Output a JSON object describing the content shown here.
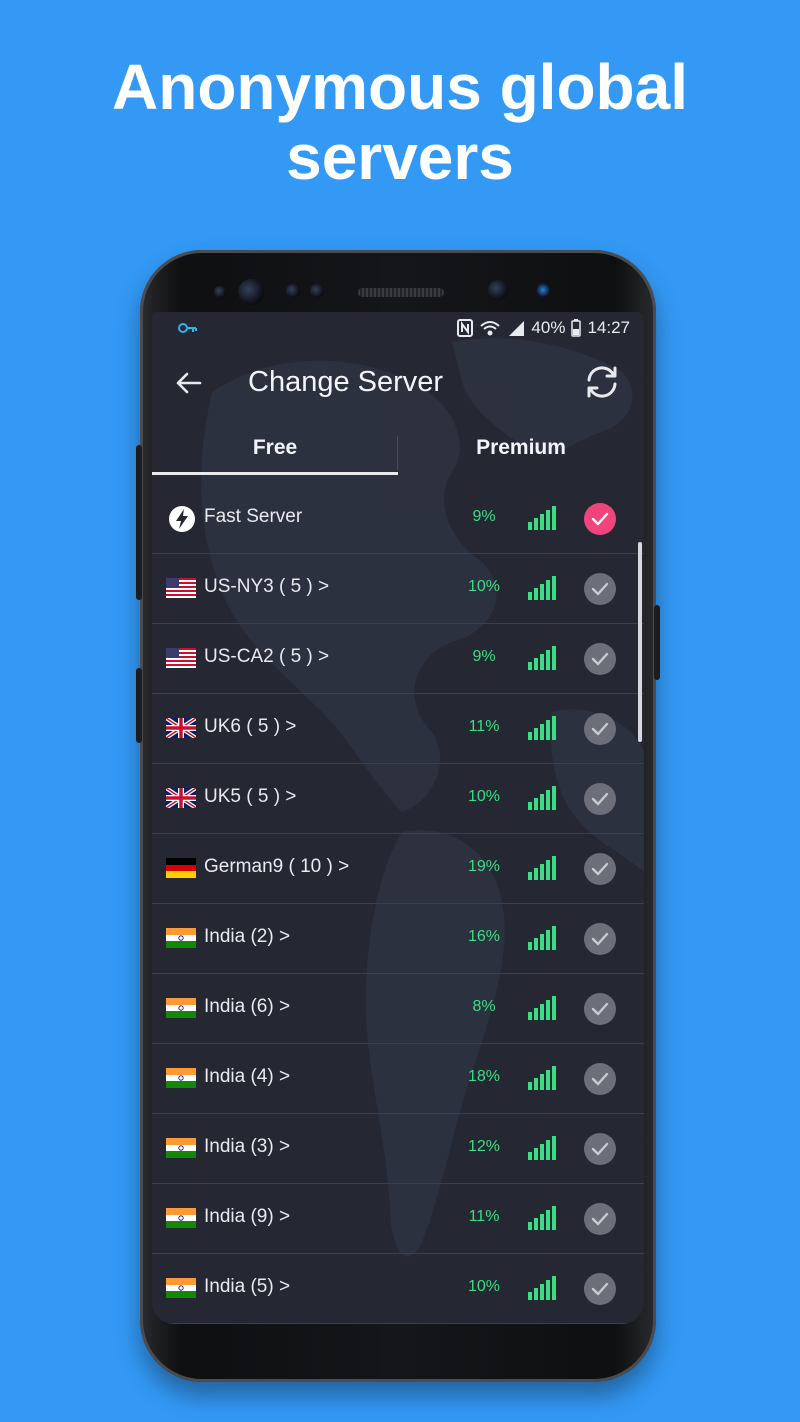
{
  "headline": {
    "line1": "Anonymous global",
    "line2": "servers"
  },
  "status_bar": {
    "battery": "40%",
    "time": "14:27"
  },
  "app_bar": {
    "title": "Change Server"
  },
  "tabs": [
    {
      "label": "Free",
      "selected": true
    },
    {
      "label": "Premium",
      "selected": false
    }
  ],
  "servers": [
    {
      "name": "Fast Server",
      "flag": "bolt-icon",
      "load": "9%",
      "selected": true
    },
    {
      "name": "US-NY3 ( 5 ) >",
      "flag": "us-flag",
      "load": "10%",
      "selected": false
    },
    {
      "name": "US-CA2 ( 5 ) >",
      "flag": "us-flag",
      "load": "9%",
      "selected": false
    },
    {
      "name": "UK6 ( 5 ) >",
      "flag": "uk-flag",
      "load": "11%",
      "selected": false
    },
    {
      "name": "UK5 ( 5 ) >",
      "flag": "uk-flag",
      "load": "10%",
      "selected": false
    },
    {
      "name": "German9 ( 10 ) >",
      "flag": "de-flag",
      "load": "19%",
      "selected": false
    },
    {
      "name": "India  (2) >",
      "flag": "in-flag",
      "load": "16%",
      "selected": false
    },
    {
      "name": "India  (6) >",
      "flag": "in-flag",
      "load": "8%",
      "selected": false
    },
    {
      "name": "India  (4) >",
      "flag": "in-flag",
      "load": "18%",
      "selected": false
    },
    {
      "name": "India  (3) >",
      "flag": "in-flag",
      "load": "12%",
      "selected": false
    },
    {
      "name": "India  (9) >",
      "flag": "in-flag",
      "load": "11%",
      "selected": false
    },
    {
      "name": "India  (5) >",
      "flag": "in-flag",
      "load": "10%",
      "selected": false
    }
  ],
  "colors": {
    "background": "#3399f5",
    "screen": "#252833",
    "accent": "#f0457a",
    "signal": "#3ddc84"
  }
}
